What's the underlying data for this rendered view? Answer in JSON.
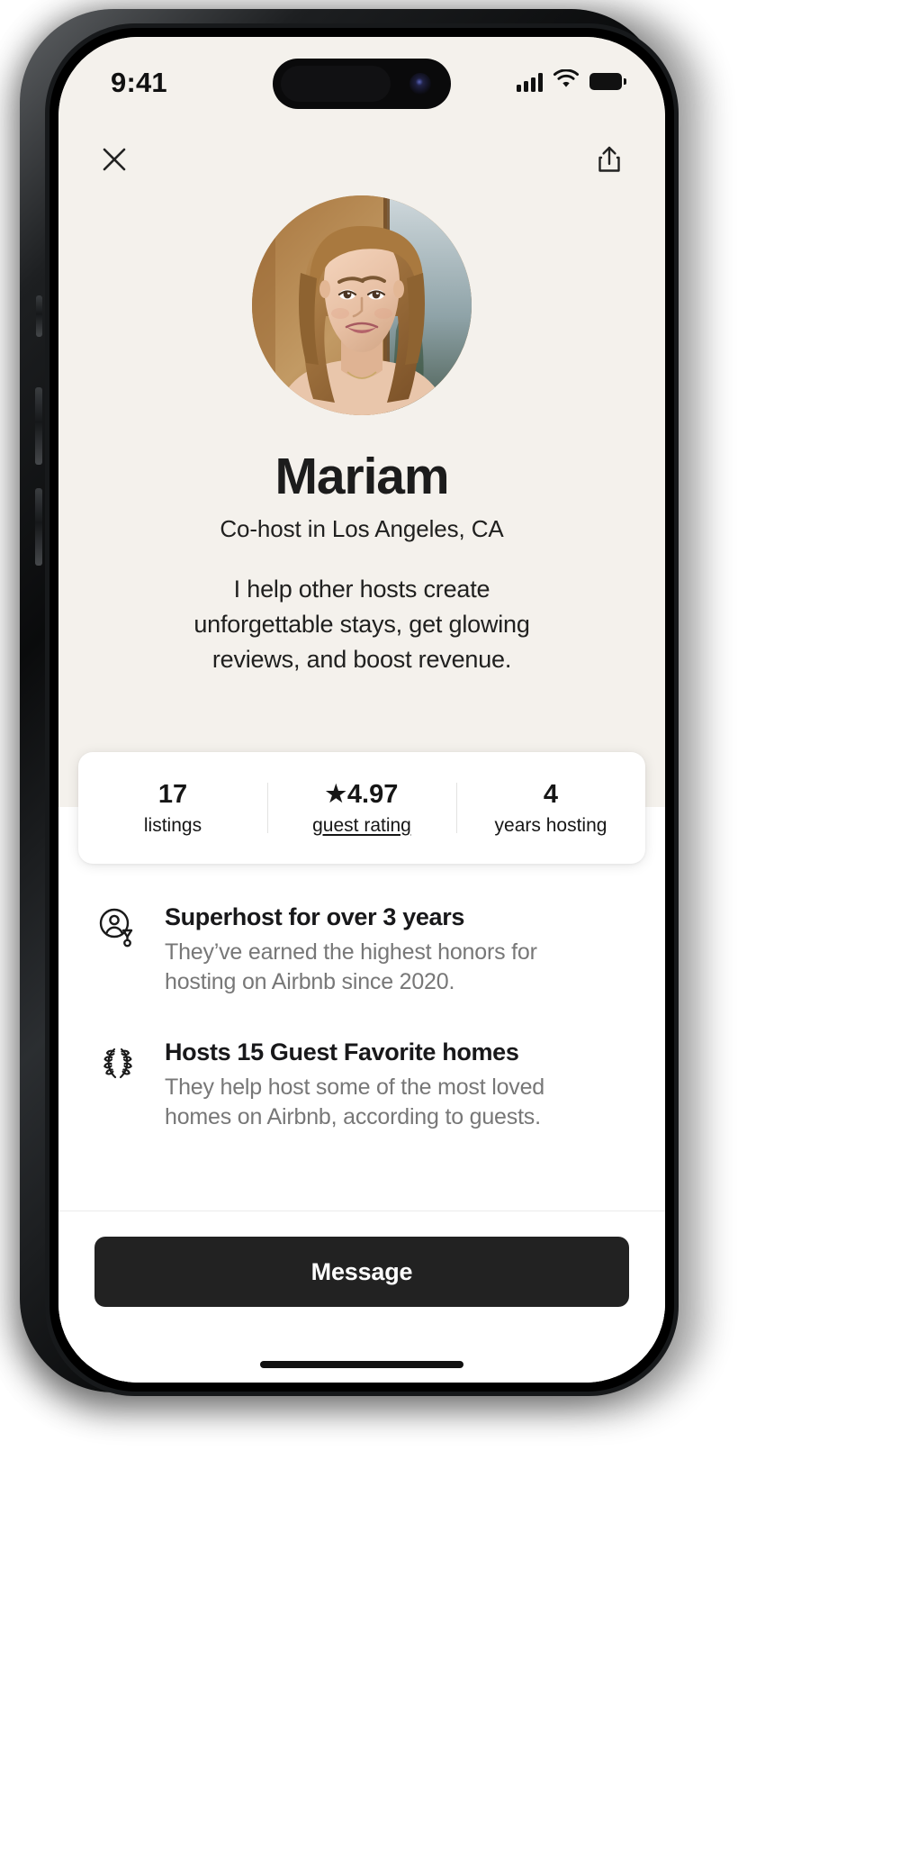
{
  "status_bar": {
    "time": "9:41",
    "cellular_icon": "signal-bars-icon",
    "wifi_icon": "wifi-icon",
    "battery_icon": "battery-icon"
  },
  "nav": {
    "close_icon": "close-icon",
    "share_icon": "share-icon"
  },
  "profile": {
    "avatar_alt": "avatar",
    "name": "Mariam",
    "role": "Co-host in Los Angeles, CA",
    "bio": "I help other hosts create unforgettable stays, get glowing reviews, and boost revenue."
  },
  "stats": [
    {
      "value": "17",
      "label": "listings",
      "star": false,
      "underlined": false
    },
    {
      "value": "4.97",
      "label": "guest rating",
      "star": true,
      "star_glyph": "★",
      "underlined": true
    },
    {
      "value": "4",
      "label": "years hosting",
      "star": false,
      "underlined": false
    }
  ],
  "features": [
    {
      "icon": "superhost-badge-icon",
      "title": "Superhost for over 3 years",
      "description": "They’ve earned the highest honors for hosting on Airbnb since 2020."
    },
    {
      "icon": "laurel-wreath-icon",
      "title": "Hosts 15 Guest Favorite homes",
      "description": "They help host some of the most loved homes on Airbnb, according to guests."
    }
  ],
  "footer": {
    "message_label": "Message"
  },
  "colors": {
    "background_top": "#F4F1EC",
    "background_bottom": "#FFFFFF",
    "text_primary": "#1C1C1C",
    "text_muted": "#777777",
    "button_dark": "#222222",
    "card_white": "#FFFFFF"
  }
}
